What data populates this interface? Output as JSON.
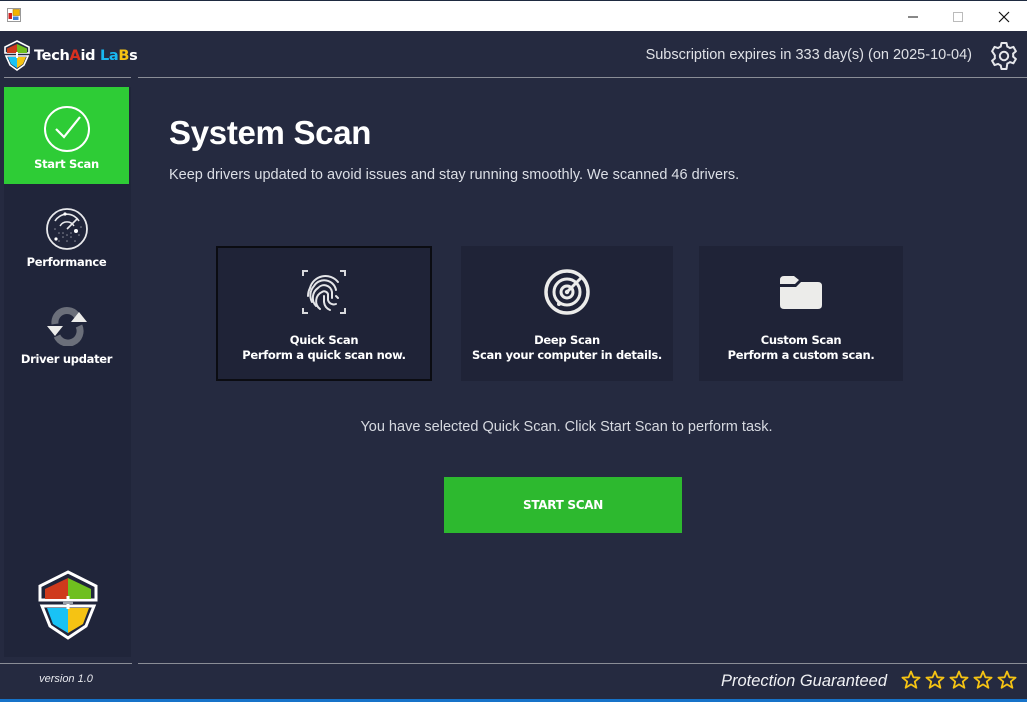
{
  "window": {
    "controls": {
      "minimize": "—",
      "maximize": "☐",
      "close": "✕"
    }
  },
  "brand": {
    "part1": "Tech",
    "part2": "A",
    "part3": "id ",
    "part4": "La",
    "part5": "B",
    "part6": "s"
  },
  "header": {
    "subscription": "Subscription expires in 333 day(s) (on 2025-10-04)",
    "settings_icon": "gear-icon"
  },
  "sidebar": {
    "items": [
      {
        "label": "Start Scan",
        "icon": "check-circle-icon",
        "active": true
      },
      {
        "label": "Performance",
        "icon": "radar-icon",
        "active": false
      },
      {
        "label": "Driver updater",
        "icon": "refresh-icon",
        "active": false
      }
    ],
    "version": "version 1.0"
  },
  "main": {
    "title": "System Scan",
    "description": "Keep drivers updated to avoid issues and stay running smoothly. We scanned 46 drivers.",
    "cards": [
      {
        "title": "Quick Scan",
        "subtitle": "Perform a quick scan now.",
        "icon": "fingerprint-icon",
        "selected": true
      },
      {
        "title": "Deep Scan",
        "subtitle": "Scan your computer in details.",
        "icon": "radar-icon",
        "selected": false
      },
      {
        "title": "Custom Scan",
        "subtitle": "Perform a custom scan.",
        "icon": "folder-icon",
        "selected": false
      }
    ],
    "status": "You have selected Quick Scan. Click Start Scan to perform task.",
    "start_button": "START SCAN"
  },
  "footer": {
    "guarantee": "Protection Guaranteed",
    "stars": 5
  },
  "colors": {
    "accent_green": "#2ecc36",
    "button_green": "#2db92f",
    "background": "#252a40",
    "panel": "#1f2337",
    "star": "#f5c313"
  }
}
